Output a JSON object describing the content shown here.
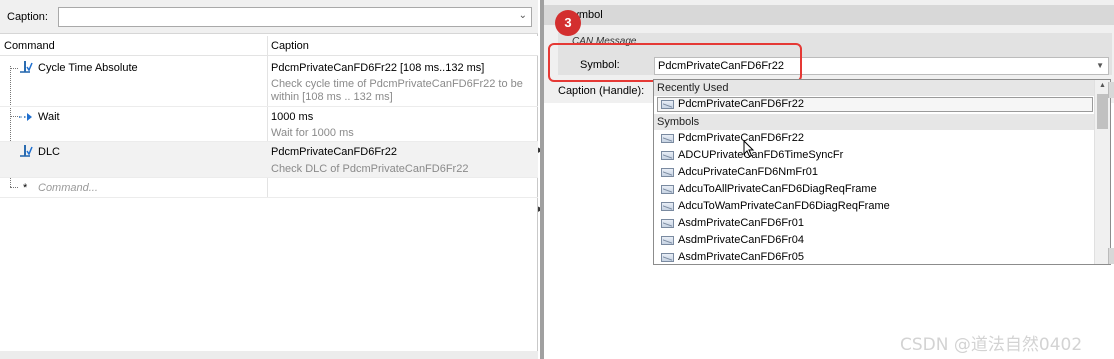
{
  "left": {
    "caption_label": "Caption:",
    "headers": {
      "command": "Command",
      "caption": "Caption"
    },
    "rows": [
      {
        "command": "Cycle Time Absolute",
        "caption": "PdcmPrivateCanFD6Fr22 [108 ms..132 ms]",
        "desc": "Check cycle time of PdcmPrivateCanFD6Fr22 to be within [108 ms .. 132 ms]"
      },
      {
        "command": "Wait",
        "caption": "1000 ms",
        "desc": "Wait for 1000 ms"
      },
      {
        "command": "DLC",
        "caption": "PdcmPrivateCanFD6Fr22",
        "desc": "Check DLC of PdcmPrivateCanFD6Fr22"
      }
    ],
    "new_row_marker": "*",
    "new_row_placeholder": "Command..."
  },
  "right": {
    "header_title": "Symbol",
    "step_badge": "3",
    "group_title": "CAN Message",
    "symbol_label": "Symbol:",
    "symbol_value": "PdcmPrivateCanFD6Fr22",
    "caption_handle_label": "Caption (Handle):"
  },
  "dropdown": {
    "recent_title": "Recently Used",
    "recent_items": [
      "PdcmPrivateCanFD6Fr22"
    ],
    "symbols_title": "Symbols",
    "symbol_items": [
      "PdcmPrivateCanFD6Fr22",
      "ADCUPrivateCanFD6TimeSyncFr",
      "AdcuPrivateCanFD6NmFr01",
      "AdcuToAllPrivateCanFD6DiagReqFrame",
      "AdcuToWamPrivateCanFD6DiagReqFrame",
      "AsdmPrivateCanFD6Fr01",
      "AsdmPrivateCanFD6Fr04",
      "AsdmPrivateCanFD6Fr05"
    ]
  },
  "watermark": "CSDN @道法自然0402",
  "colors": {
    "highlight": "#e53935",
    "badge": "#d32f2f",
    "selection": "#f2f2f2"
  }
}
